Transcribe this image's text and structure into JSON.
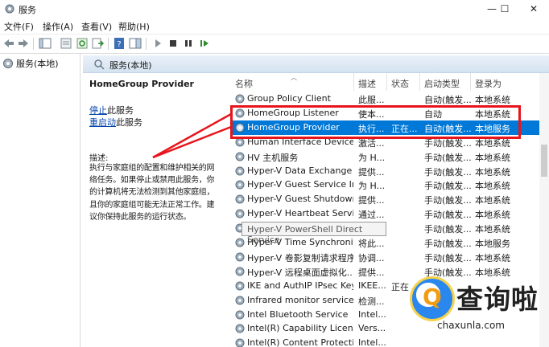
{
  "window": {
    "title": "服务",
    "controls": [
      "—",
      "☐",
      "✕"
    ]
  },
  "menu": [
    "文件(F)",
    "操作(A)",
    "查看(V)",
    "帮助(H)"
  ],
  "tree": {
    "root": "服务(本地)"
  },
  "header": {
    "title": "服务(本地)"
  },
  "description": {
    "service_name": "HomeGroup Provider",
    "stop_link": "停止",
    "stop_suffix": "此服务",
    "restart_link": "重启动",
    "restart_suffix": "此服务",
    "label": "描述:",
    "lines": [
      "执行与家庭组的配置和维护相关的网",
      "络任务。如果停止或禁用此服务，你",
      "的计算机将无法检测到其他家庭组，",
      "且你的家庭组可能无法正常工作。建",
      "议你保持此服务的运行状态。"
    ]
  },
  "columns": [
    "名称",
    "描述",
    "状态",
    "启动类型",
    "登录为"
  ],
  "services": [
    {
      "name": "Group Policy Client",
      "desc": "此服...",
      "status": "",
      "startup": "自动(触发...",
      "logon": "本地系统",
      "selected": false
    },
    {
      "name": "HomeGroup Listener",
      "desc": "使本...",
      "status": "",
      "startup": "自动",
      "logon": "本地系统",
      "selected": false
    },
    {
      "name": "HomeGroup Provider",
      "desc": "执行...",
      "status": "正在...",
      "startup": "自动(触发...",
      "logon": "本地服务",
      "selected": true
    },
    {
      "name": "Human Interface Device ...",
      "desc": "激活...",
      "status": "",
      "startup": "手动(触发...",
      "logon": "本地系统",
      "selected": false
    },
    {
      "name": "HV 主机服务",
      "desc": "为 H...",
      "status": "",
      "startup": "手动(触发...",
      "logon": "本地系统",
      "selected": false
    },
    {
      "name": "Hyper-V Data Exchange ...",
      "desc": "提供...",
      "status": "",
      "startup": "手动(触发...",
      "logon": "本地系统",
      "selected": false
    },
    {
      "name": "Hyper-V Guest Service In...",
      "desc": "为 H...",
      "status": "",
      "startup": "手动(触发...",
      "logon": "本地系统",
      "selected": false
    },
    {
      "name": "Hyper-V Guest Shutdown...",
      "desc": "提供...",
      "status": "",
      "startup": "手动(触发...",
      "logon": "本地系统",
      "selected": false
    },
    {
      "name": "Hyper-V Heartbeat Service",
      "desc": "通过...",
      "status": "",
      "startup": "手动(触发...",
      "logon": "本地系统",
      "selected": false
    },
    {
      "name": "Hyper-V PowerShell Direct Service",
      "desc": "",
      "status": "",
      "startup": "手动(触发...",
      "logon": "本地系统",
      "selected": false
    },
    {
      "name": "Hyper-V Time Synchroniz...",
      "desc": "将此...",
      "status": "",
      "startup": "手动(触发...",
      "logon": "本地服务",
      "selected": false
    },
    {
      "name": "Hyper-V 卷影复制请求程序",
      "desc": "协调...",
      "status": "",
      "startup": "手动(触发...",
      "logon": "本地系统",
      "selected": false
    },
    {
      "name": "Hyper-V 远程桌面虚拟化...",
      "desc": "提供...",
      "status": "",
      "startup": "手动(触发...",
      "logon": "本地系统",
      "selected": false
    },
    {
      "name": "IKE and AuthIP IPsec Key...",
      "desc": "IKEE...",
      "status": "正在",
      "startup": "",
      "logon": "",
      "selected": false
    },
    {
      "name": "Infrared monitor service",
      "desc": "检测...",
      "status": "",
      "startup": "",
      "logon": "",
      "selected": false
    },
    {
      "name": "Intel Bluetooth Service",
      "desc": "Intel...",
      "status": "",
      "startup": "",
      "logon": "",
      "selected": false
    },
    {
      "name": "Intel(R) Capability Licensi...",
      "desc": "Vers...",
      "status": "",
      "startup": "",
      "logon": "",
      "selected": false
    },
    {
      "name": "Intel(R) Content Protectio...",
      "desc": "Intel...",
      "status": "",
      "startup": "",
      "logon": "",
      "selected": false
    }
  ],
  "tooltip": "Hyper-V PowerShell Direct Service",
  "watermark": {
    "cn": "查询啦",
    "en": "chaxunla.com"
  },
  "colors": {
    "selection": "#0078d7",
    "highlight": "#e8141b",
    "link": "#0645ad"
  }
}
